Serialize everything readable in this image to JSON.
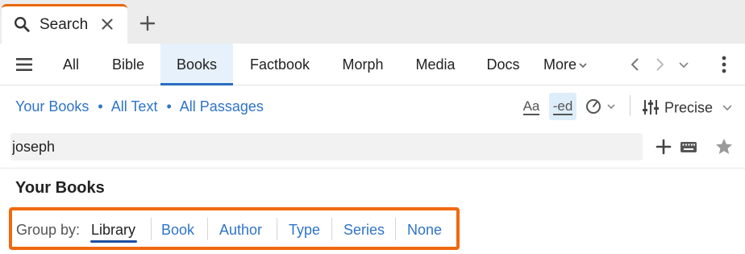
{
  "tab": {
    "icon": "search-icon",
    "label": "Search",
    "close_icon": "close-icon",
    "new_tab_icon": "plus-icon"
  },
  "nav": {
    "menu_icon": "hamburger-menu-icon",
    "tabs": [
      {
        "label": "All",
        "active": false
      },
      {
        "label": "Bible",
        "active": false
      },
      {
        "label": "Books",
        "active": true
      },
      {
        "label": "Factbook",
        "active": false
      },
      {
        "label": "Morph",
        "active": false
      },
      {
        "label": "Media",
        "active": false
      },
      {
        "label": "Docs",
        "active": false
      }
    ],
    "more_label": "More",
    "active_color": "#2a6ec4"
  },
  "scope": {
    "books": "Your Books",
    "text": "All Text",
    "passages": "All Passages",
    "separator": "•",
    "link_color": "#2f74c8"
  },
  "options": {
    "case_label": "Aa",
    "inflection_label": "-ed",
    "match_label": "Precise"
  },
  "search": {
    "value": "joseph"
  },
  "results": {
    "title": "Your Books",
    "group_by_label": "Group by:",
    "group_options": [
      {
        "label": "Library",
        "active": true
      },
      {
        "label": "Book",
        "active": false
      },
      {
        "label": "Author",
        "active": false
      },
      {
        "label": "Type",
        "active": false
      },
      {
        "label": "Series",
        "active": false
      },
      {
        "label": "None",
        "active": false
      }
    ],
    "highlight_color": "#f0690f"
  }
}
